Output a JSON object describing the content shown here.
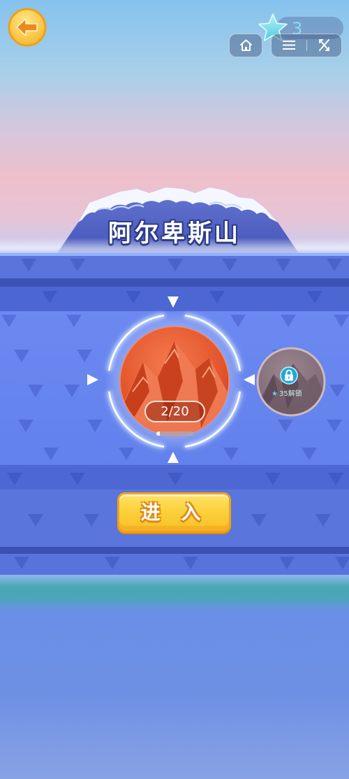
{
  "topbar": {
    "star_count": "3"
  },
  "title": "阿尔卑斯山",
  "level": {
    "progress_text": "2/20",
    "progress_fraction": 0.1
  },
  "locked_planet": {
    "label": "35解锁"
  },
  "enter_button": {
    "label": "进 入"
  },
  "icons": {
    "back": "back-arrow-icon",
    "star": "star-icon",
    "home": "home-icon",
    "menu": "menu-icon",
    "close": "close-icon",
    "lock": "lock-icon",
    "nav_arrows": "triangle-arrow-icon"
  },
  "colors": {
    "sky_top": "#86c2ee",
    "sky_pink": "#eebfcb",
    "panel_blue": "#6a88f0",
    "planet_red": "#e0532c",
    "button_yellow": "#fcd13c",
    "star_cyan": "#8adcf0"
  }
}
